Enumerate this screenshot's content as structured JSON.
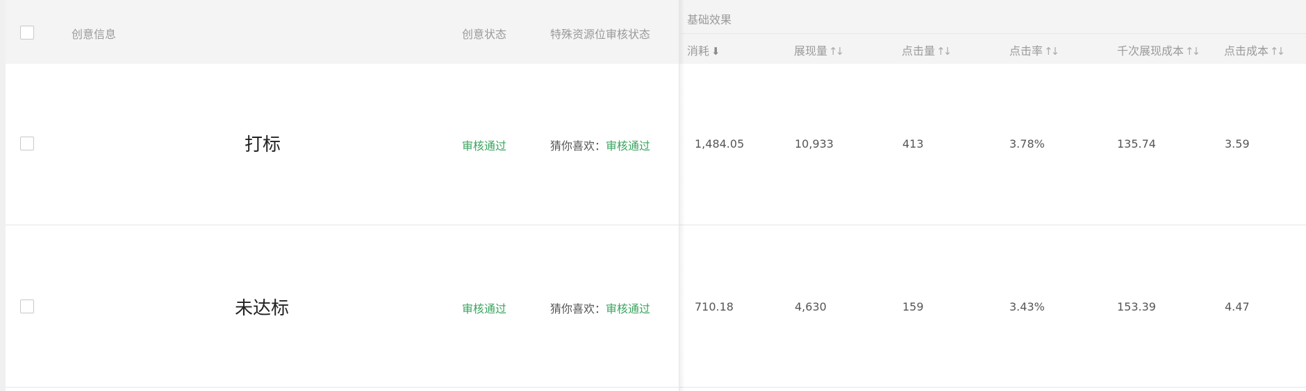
{
  "header": {
    "creative_info": "创意信息",
    "creative_status": "创意状态",
    "special_review_status": "特殊资源位审核状态",
    "group_basic_effect": "基础效果",
    "metrics": [
      {
        "label": "消耗",
        "sort": "desc"
      },
      {
        "label": "展现量",
        "sort": "both"
      },
      {
        "label": "点击量",
        "sort": "both"
      },
      {
        "label": "点击率",
        "sort": "both"
      },
      {
        "label": "千次展现成本",
        "sort": "both"
      },
      {
        "label": "点击成本",
        "sort": "both"
      }
    ]
  },
  "rows": [
    {
      "title": "打标",
      "creative_status": "审核通过",
      "special_prefix": "猜你喜欢：",
      "special_status": "审核通过",
      "cost": "1,484.05",
      "impressions": "10,933",
      "clicks": "413",
      "ctr": "3.78%",
      "cpm": "135.74",
      "cpc": "3.59"
    },
    {
      "title": "未达标",
      "creative_status": "审核通过",
      "special_prefix": "猜你喜欢：",
      "special_status": "审核通过",
      "cost": "710.18",
      "impressions": "4,630",
      "clicks": "159",
      "ctr": "3.43%",
      "cpm": "153.39",
      "cpc": "4.47"
    }
  ],
  "icons": {
    "sort_desc": "arrow-down",
    "sort_both": "sort-up-down"
  }
}
